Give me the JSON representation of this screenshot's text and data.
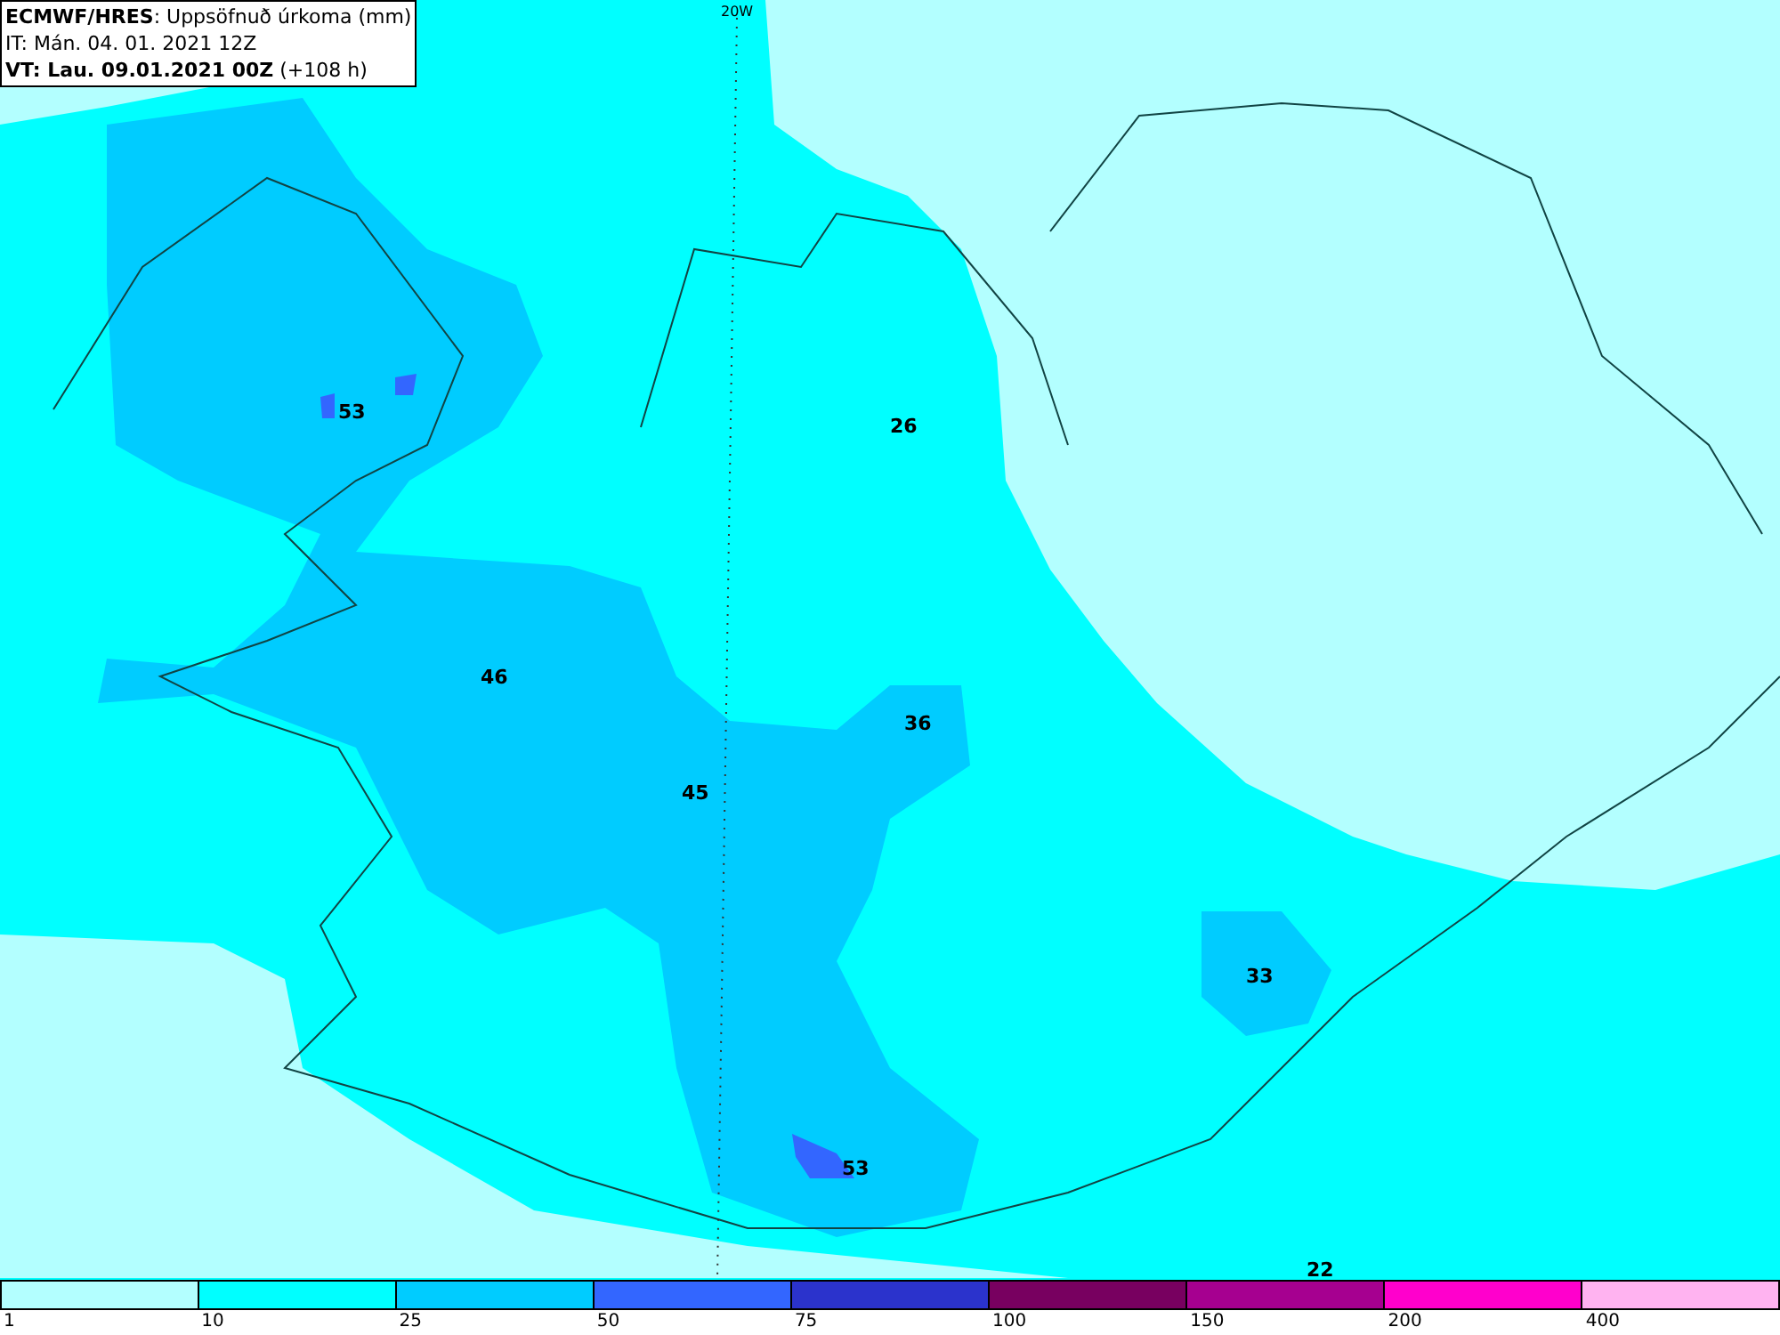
{
  "header": {
    "lines": [
      "**ECMWF/HRES**: Uppsöfnuð úrkoma (mm)",
      "IT: Mán. 04. 01. 2021 12Z",
      "**VT: Lau. 09.01.2021 00Z** (+108 h)"
    ]
  },
  "map": {
    "meridian_label": "20W",
    "value_labels": [
      "53",
      "26",
      "46",
      "36",
      "45",
      "33",
      "53",
      "22"
    ]
  },
  "legend": {
    "bins": [
      {
        "color": "#b3ffff"
      },
      {
        "color": "#00ffff"
      },
      {
        "color": "#00ccff"
      },
      {
        "color": "#3366ff"
      },
      {
        "color": "#2b33cc"
      },
      {
        "color": "#780060"
      },
      {
        "color": "#a60090"
      },
      {
        "color": "#ff00cc"
      },
      {
        "color": "#ffb3f0"
      }
    ],
    "ticks": [
      "1",
      "10",
      "25",
      "50",
      "75",
      "100",
      "150",
      "200",
      "400"
    ]
  }
}
